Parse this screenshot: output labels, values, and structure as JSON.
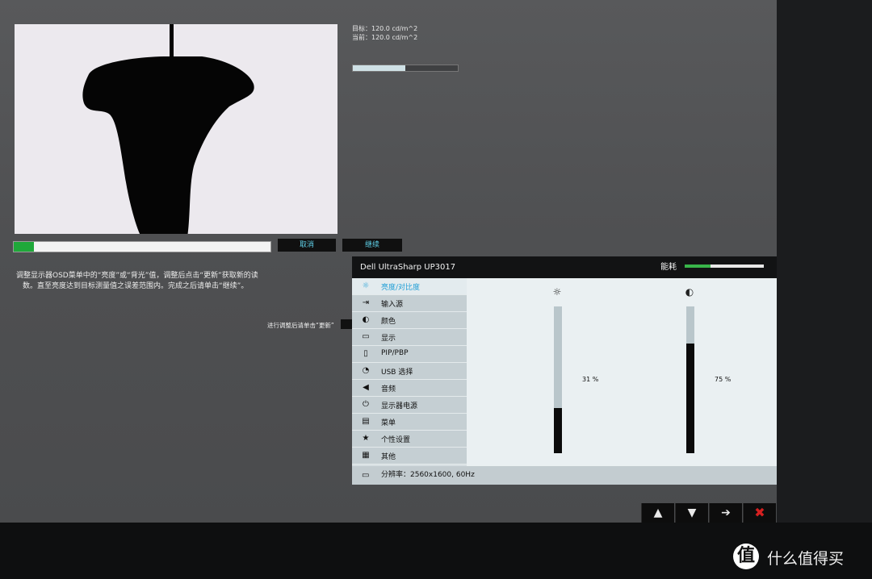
{
  "calibration": {
    "target_label": "目标：120.0 cd/m^2",
    "current_label": "当前：120.0 cd/m^2",
    "match_level": 0.5,
    "progress": 0.08,
    "cancel_label": "取消",
    "continue_label": "继续",
    "instruction_line1": "调整显示器OSD菜单中的“亮度”或“背光”值，调整后点击“更新”获取新的读",
    "instruction_line2": "数。直至亮度达到目标测量值之误差范围内。完成之后请单击“继续”。",
    "hint": "进行调整后请单击“更新”"
  },
  "osd": {
    "model": "Dell UltraSharp UP3017",
    "energy_label": "能耗",
    "energy_level": 0.33,
    "menu": [
      {
        "label": "亮度/对比度",
        "icon": "☼"
      },
      {
        "label": "输入源",
        "icon": "⇥"
      },
      {
        "label": "颜色",
        "icon": "◐"
      },
      {
        "label": "显示",
        "icon": "▭"
      },
      {
        "label": "PIP/PBP",
        "icon": "▯"
      },
      {
        "label": "USB 选择",
        "icon": "◔"
      },
      {
        "label": "音频",
        "icon": "◀"
      },
      {
        "label": "显示器电源",
        "icon": "⏻"
      },
      {
        "label": "菜单",
        "icon": "▤"
      },
      {
        "label": "个性设置",
        "icon": "★"
      },
      {
        "label": "其他",
        "icon": "▦"
      }
    ],
    "brightness": {
      "value": 31,
      "label": "31 %",
      "icon": "☼"
    },
    "contrast": {
      "value": 75,
      "label": "75 %",
      "icon": "◐"
    },
    "resolution_text": "分辨率：2560x1600, 60Hz",
    "resolution_icon": "▭"
  },
  "nav_buttons": {
    "up": "▲",
    "down": "▼",
    "right": "➔",
    "close": "✖"
  },
  "watermark": {
    "logo": "值",
    "text": "什么值得买"
  },
  "colors": {
    "accent": "#1f9ed6",
    "progress": "#1fa83a",
    "close": "#d62020"
  }
}
